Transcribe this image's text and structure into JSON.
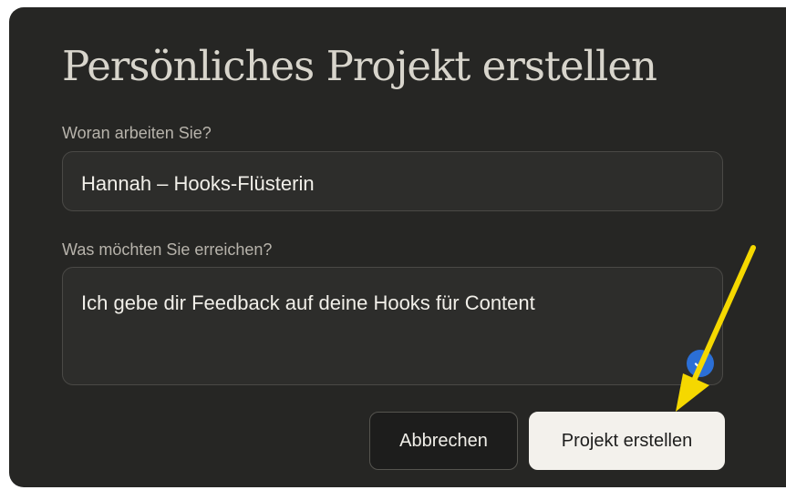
{
  "dialog": {
    "title": "Persönliches Projekt erstellen",
    "name_field": {
      "label": "Woran arbeiten Sie?",
      "value": "Hannah – Hooks-Flüsterin"
    },
    "goal_field": {
      "label": "Was möchten Sie erreichen?",
      "value": "Ich gebe dir Feedback auf deine Hooks für Content"
    },
    "buttons": {
      "cancel_label": "Abbrechen",
      "create_label": "Projekt erstellen"
    }
  },
  "icons": {
    "textarea_badge": "check-icon",
    "annotation": "arrow-icon"
  },
  "colors": {
    "dialog_background": "#262624",
    "field_background": "#2d2d2b",
    "primary_button": "#f3f1ec",
    "badge_blue": "#2b6fd6",
    "annotation_arrow": "#f5d800"
  }
}
